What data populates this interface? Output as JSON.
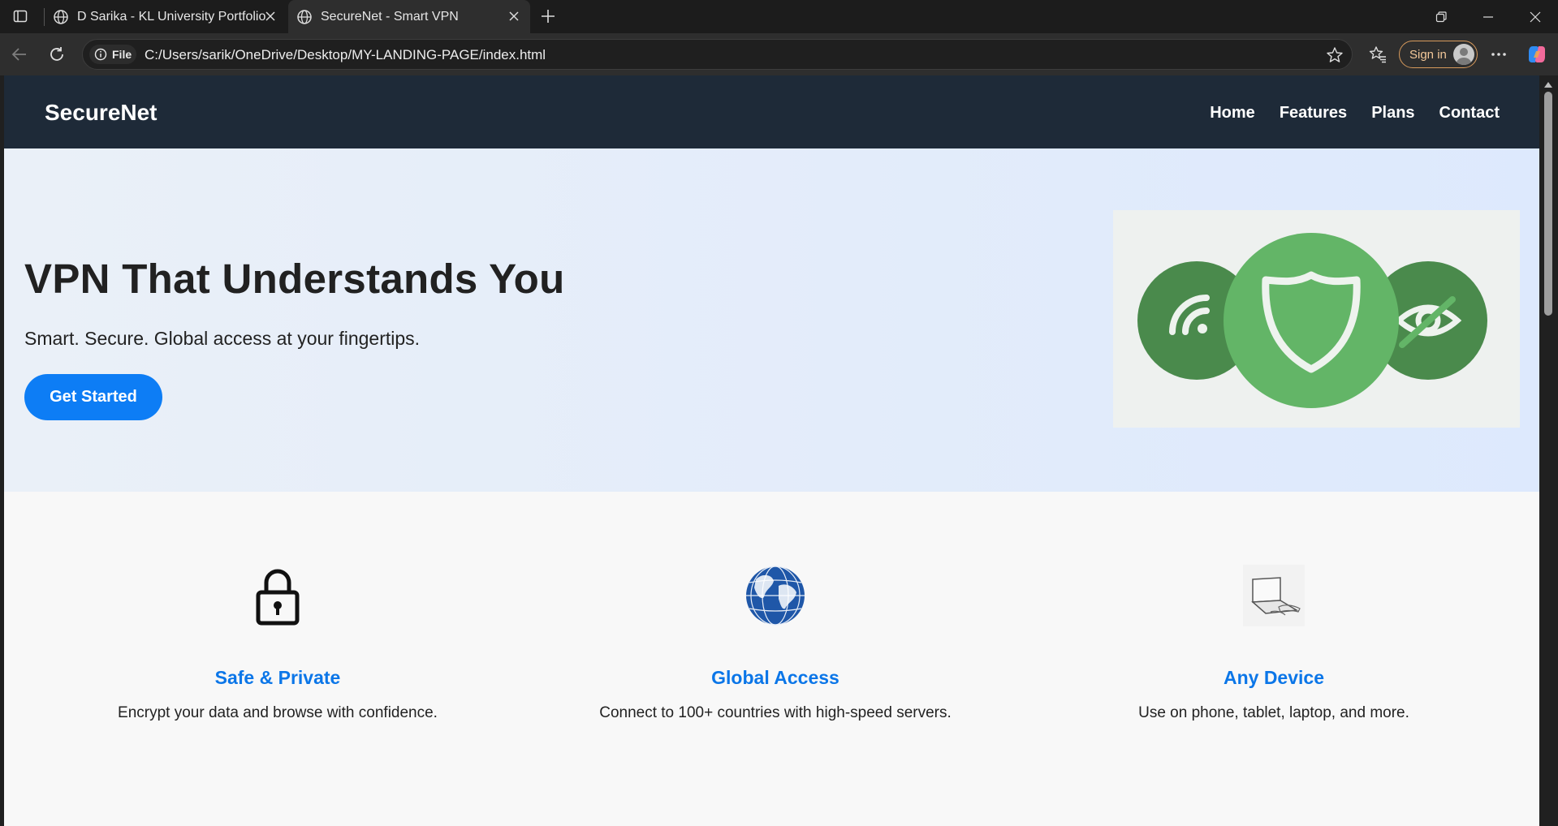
{
  "browser": {
    "tabs": [
      {
        "title": "D Sarika - KL University Portfolio",
        "active": false
      },
      {
        "title": "SecureNet - Smart VPN",
        "active": true
      }
    ],
    "address": {
      "scheme_label": "File",
      "url": "C:/Users/sarik/OneDrive/Desktop/MY-LANDING-PAGE/index.html"
    },
    "signin_label": "Sign in",
    "accent": "#d79a5c"
  },
  "site": {
    "brand": "SecureNet",
    "nav": [
      "Home",
      "Features",
      "Plans",
      "Contact"
    ],
    "hero": {
      "title": "VPN That Understands You",
      "subtitle": "Smart. Secure. Global access at your fingertips.",
      "cta": "Get Started"
    },
    "features": [
      {
        "icon": "padlock-icon",
        "title": "Safe & Private",
        "text": "Encrypt your data and browse with confidence."
      },
      {
        "icon": "globe-icon",
        "title": "Global Access",
        "text": "Connect to 100+ countries with high-speed servers."
      },
      {
        "icon": "laptop-icon",
        "title": "Any Device",
        "text": "Use on phone, tablet, laptop, and more."
      }
    ],
    "colors": {
      "nav_bg": "#1e2a38",
      "primary": "#0d7df5",
      "feature_title": "#0b76e8",
      "shield_green": "#63b567"
    }
  }
}
